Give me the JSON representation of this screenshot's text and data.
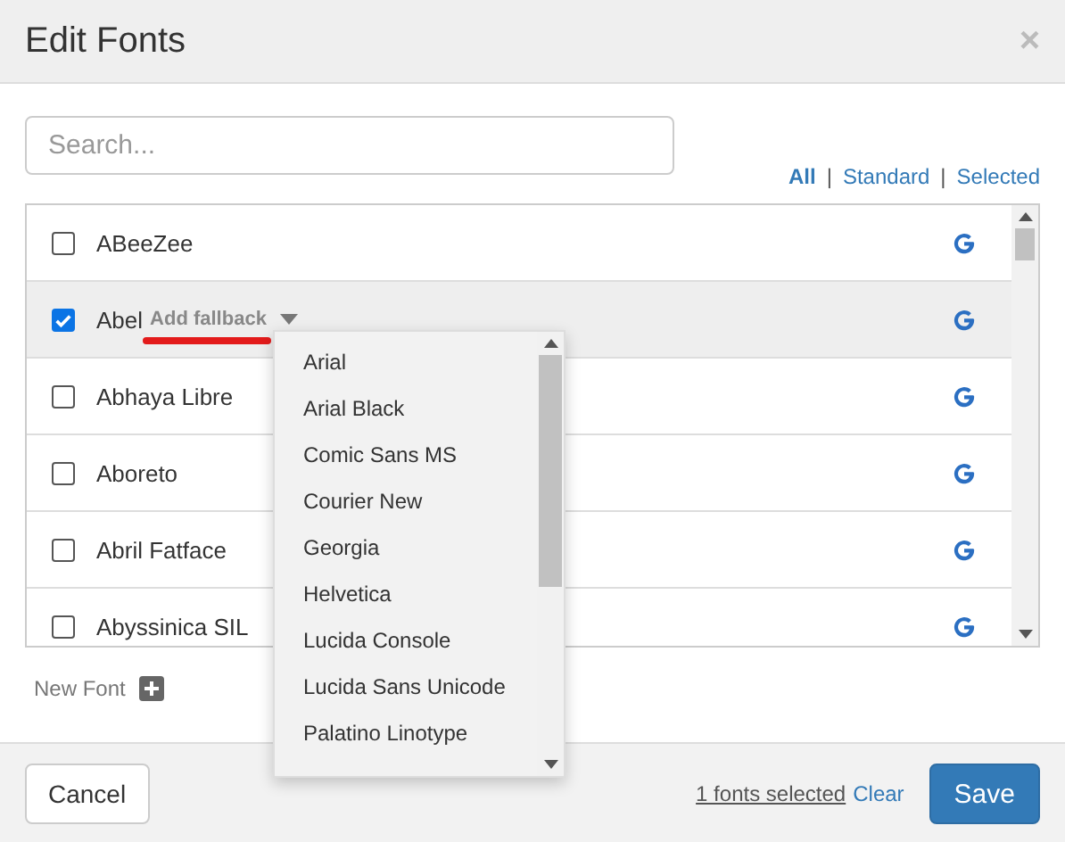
{
  "dialog": {
    "title": "Edit Fonts",
    "close": "×"
  },
  "search": {
    "placeholder": "Search..."
  },
  "filters": {
    "separator": "|",
    "items": [
      {
        "label": "All",
        "selected": true
      },
      {
        "label": "Standard",
        "selected": false
      },
      {
        "label": "Selected",
        "selected": false
      }
    ]
  },
  "fonts": [
    {
      "name": "ABeeZee",
      "checked": false
    },
    {
      "name": "Abel",
      "checked": true,
      "fallback": "Add fallback"
    },
    {
      "name": "Abhaya Libre",
      "checked": false
    },
    {
      "name": "Aboreto",
      "checked": false
    },
    {
      "name": "Abril Fatface",
      "checked": false
    },
    {
      "name": "Abyssinica SIL",
      "checked": false
    }
  ],
  "fallback_menu": {
    "options": [
      "Arial",
      "Arial Black",
      "Comic Sans MS",
      "Courier New",
      "Georgia",
      "Helvetica",
      "Lucida Console",
      "Lucida Sans Unicode",
      "Palatino Linotype"
    ]
  },
  "new_font": "New Font",
  "footer": {
    "cancel": "Cancel",
    "count": "1 fonts selected",
    "clear": "Clear",
    "save": "Save"
  }
}
